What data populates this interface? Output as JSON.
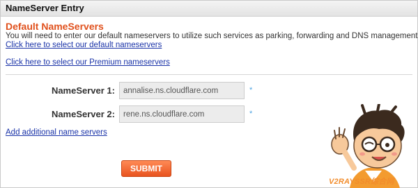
{
  "panel": {
    "title": "NameServer Entry"
  },
  "defaults": {
    "title": "Default NameServers",
    "description": "You will need to enter our default nameservers to utilize such services as parking, forwarding and DNS management.",
    "select_default_link": "Click here to select our default nameservers",
    "select_premium_link": "Click here to select our Premium nameservers"
  },
  "nameservers": [
    {
      "label": "NameServer 1:",
      "value": "annalise.ns.cloudflare.com",
      "required_mark": "*"
    },
    {
      "label": "NameServer 2:",
      "value": "rene.ns.cloudflare.com",
      "required_mark": "*"
    }
  ],
  "add_link": "Add additional name servers",
  "submit_label": "SUBMIT",
  "watermark": {
    "text": "V2RAYSSR综合网"
  },
  "colors": {
    "accent": "#e0501c",
    "link": "#1a33a8",
    "required": "#4aa0e0"
  },
  "icons": {
    "mascot": "cartoon-mascot-icon"
  }
}
